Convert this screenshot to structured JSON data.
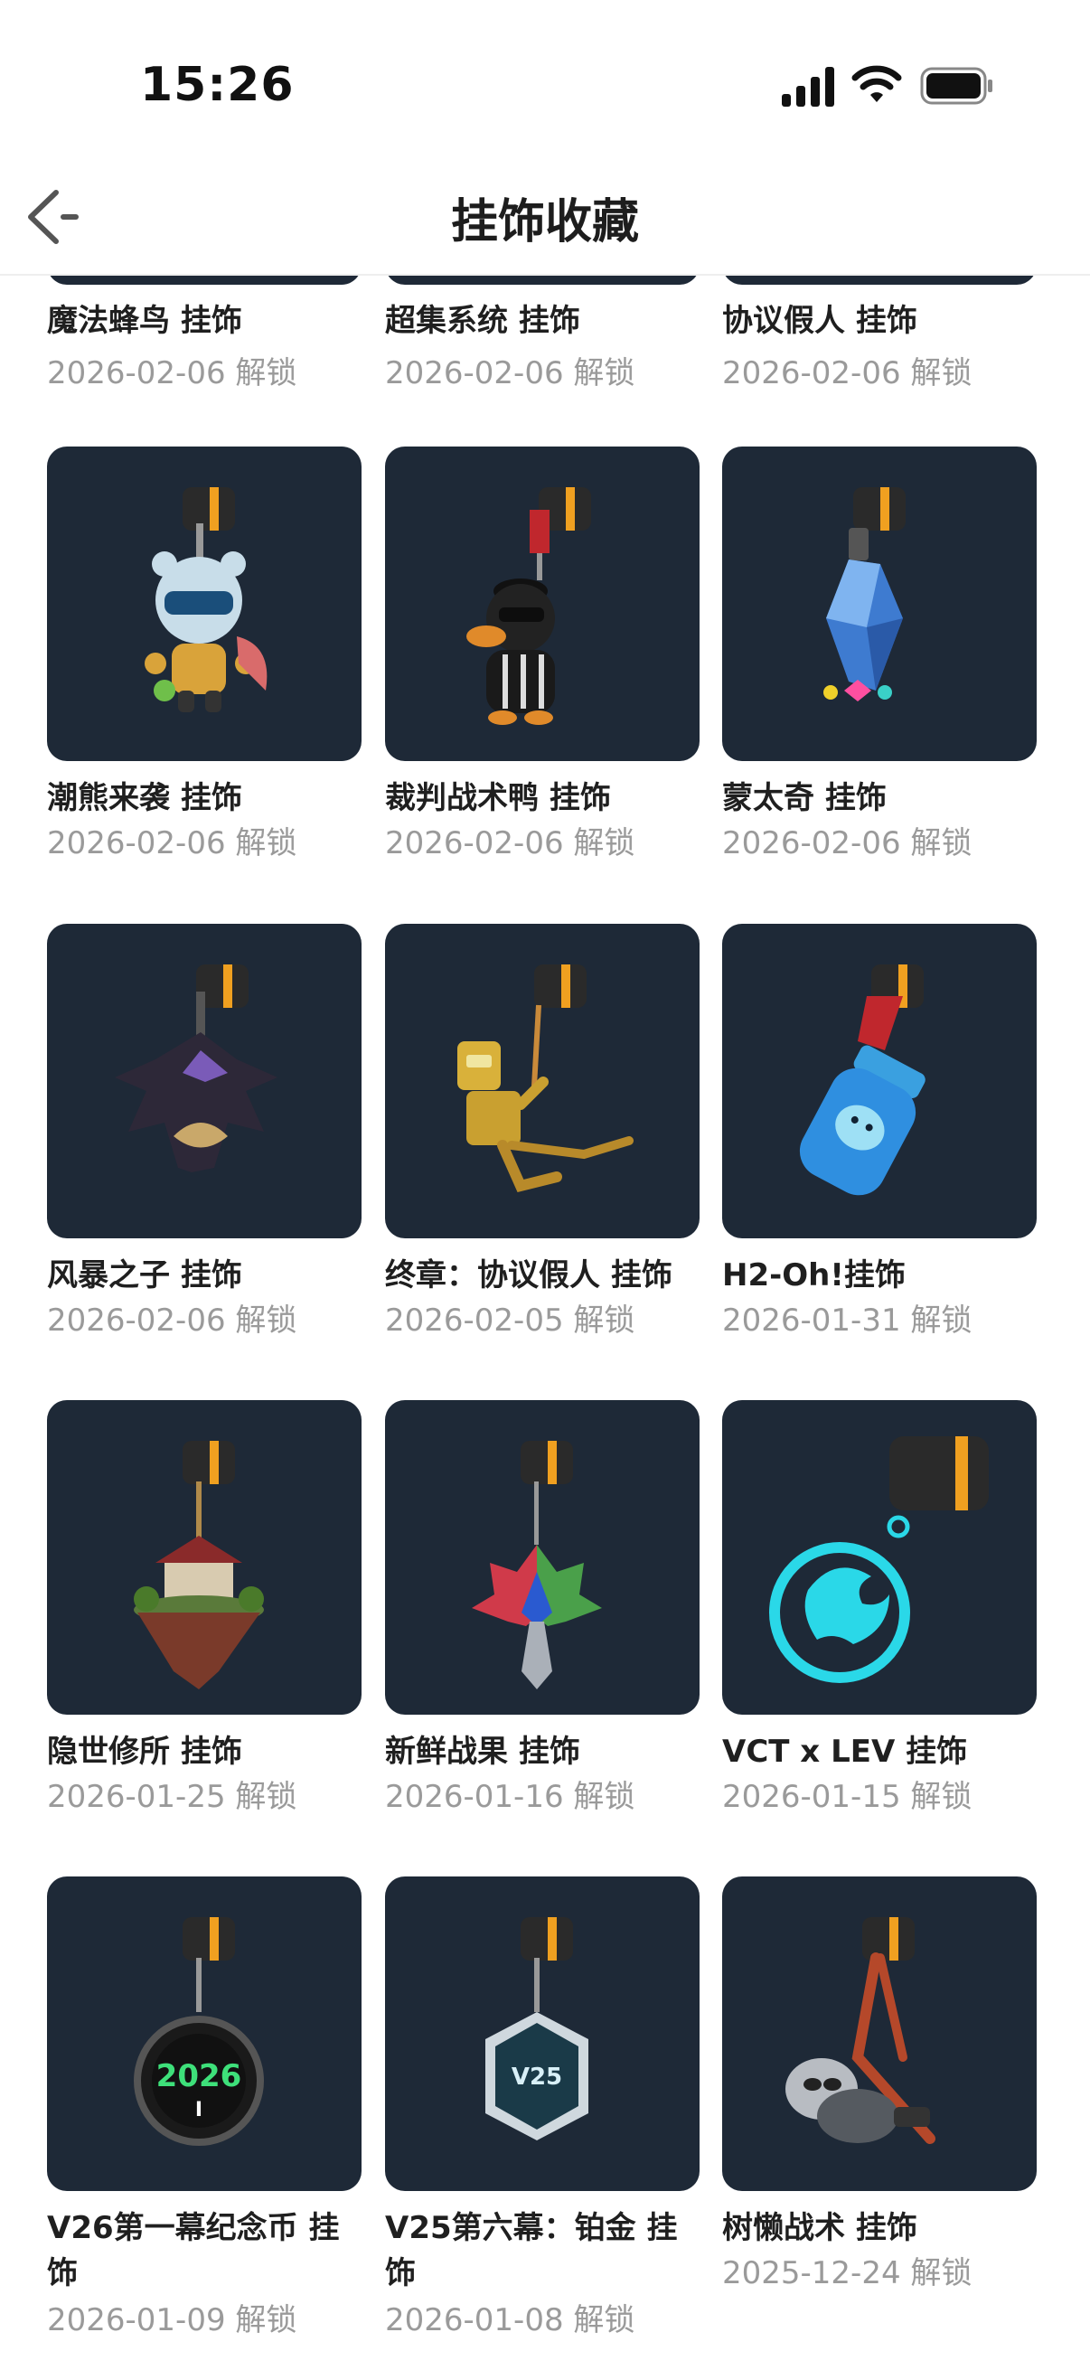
{
  "status_bar": {
    "time": "15:26"
  },
  "header": {
    "title": "挂饰收藏"
  },
  "top_row": [
    {
      "name": "魔法蜂鸟 挂饰",
      "date": "2026-02-06 解锁"
    },
    {
      "name": "超集系统 挂饰",
      "date": "2026-02-06 解锁"
    },
    {
      "name": "协议假人 挂饰",
      "date": "2026-02-06 解锁"
    }
  ],
  "items": [
    {
      "name": "潮熊来袭 挂饰",
      "date": "2026-02-06 解锁",
      "icon": "bear-astronaut-icon"
    },
    {
      "name": "裁判战术鸭 挂饰",
      "date": "2026-02-06 解锁",
      "icon": "referee-duck-icon"
    },
    {
      "name": "蒙太奇 挂饰",
      "date": "2026-02-06 解锁",
      "icon": "crystal-icon"
    },
    {
      "name": "风暴之子 挂饰",
      "date": "2026-02-06 解锁",
      "icon": "storm-mask-icon"
    },
    {
      "name": "终章：协议假人 挂饰",
      "date": "2026-02-05 解锁",
      "icon": "golden-robot-icon"
    },
    {
      "name": "H2-Oh!挂饰",
      "date": "2026-01-31 解锁",
      "icon": "water-bottle-icon"
    },
    {
      "name": "隐世修所 挂饰",
      "date": "2026-01-25 解锁",
      "icon": "floating-island-icon"
    },
    {
      "name": "新鲜战果 挂饰",
      "date": "2026-01-16 解锁",
      "icon": "leaf-icon"
    },
    {
      "name": "VCT x LEV 挂饰",
      "date": "2026-01-15 解锁",
      "icon": "dragon-emblem-icon"
    },
    {
      "name": "V26第一幕纪念币 挂饰",
      "date": "2026-01-09 解锁",
      "icon": "coin-2026-icon",
      "coin_text": "2026",
      "coin_sub": "I"
    },
    {
      "name": "V25第六幕：铂金 挂饰",
      "date": "2026-01-08 解锁",
      "icon": "platinum-badge-icon",
      "badge_text": "V25"
    },
    {
      "name": "树懒战术 挂饰",
      "date": "2025-12-24 解锁",
      "icon": "sloth-icon"
    }
  ],
  "colors": {
    "tile_bg": "#1e2937",
    "accent_orange": "#f0a020",
    "date_gray": "#9a9a9a"
  }
}
